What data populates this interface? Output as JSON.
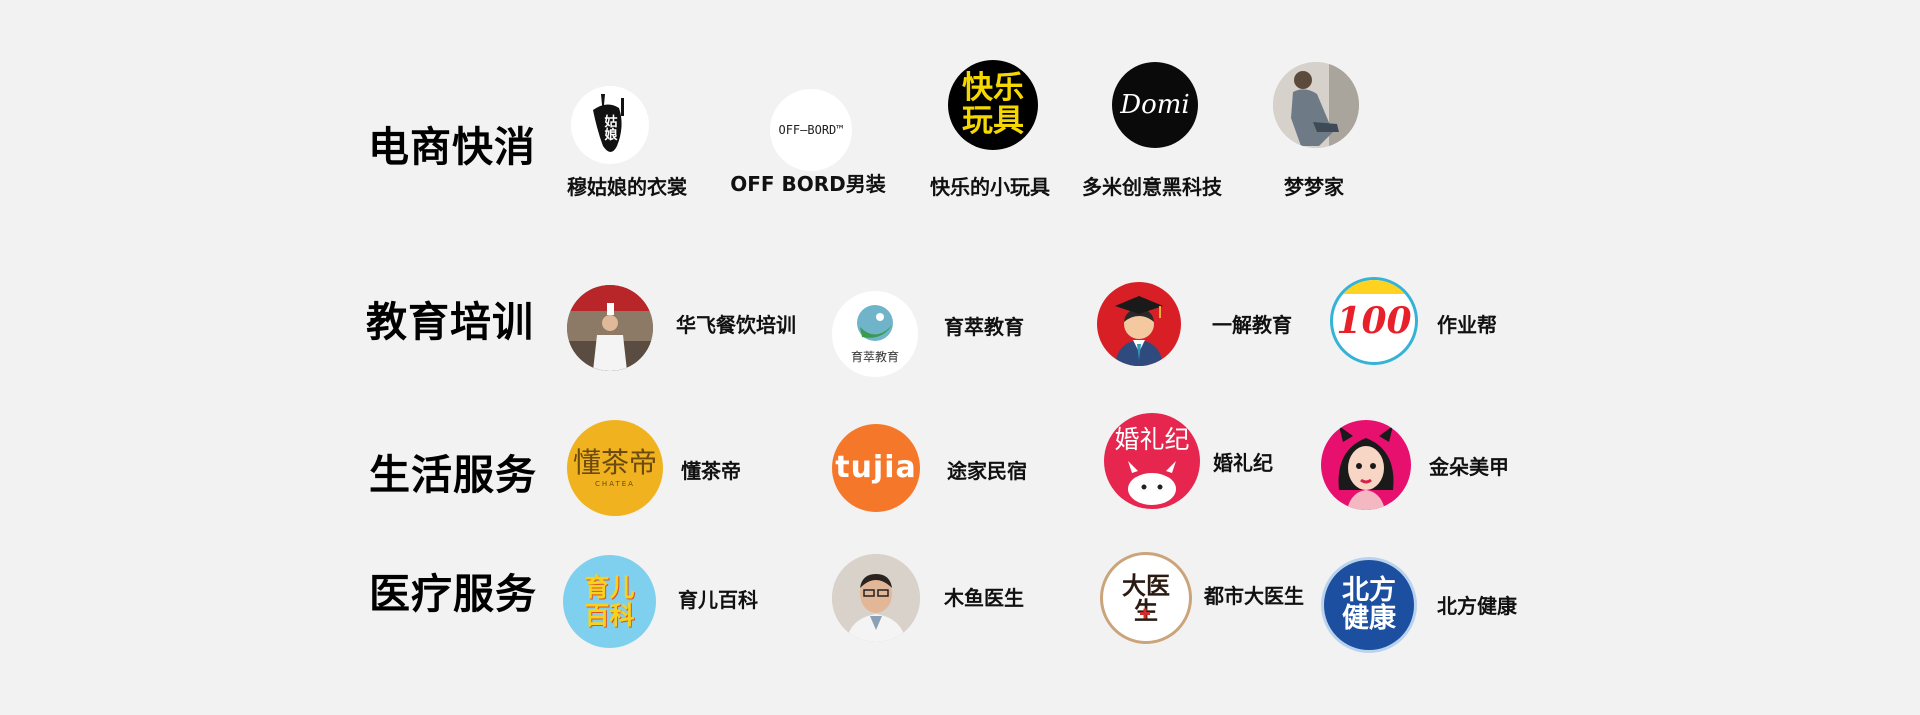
{
  "categories": {
    "ecommerce": "电商快消",
    "education": "教育培训",
    "life": "生活服务",
    "medical": "医疗服务"
  },
  "brands": {
    "mugu": {
      "name": "穆姑娘的衣裳",
      "logo_text": "姑娘"
    },
    "offbord": {
      "name": "OFF BORD男装",
      "logo_text": "OFF—BORD™"
    },
    "kuaile": {
      "name": "快乐的小玩具",
      "logo_text": "快乐玩具"
    },
    "duomi": {
      "name": "多米创意黑科技",
      "logo_text": "Domi"
    },
    "mengmeng": {
      "name": "梦梦家"
    },
    "huafei": {
      "name": "华飞餐饮培训"
    },
    "yucui": {
      "name": "育萃教育",
      "logo_text": "育萃教育"
    },
    "yijie": {
      "name": "一解教育"
    },
    "zuoye": {
      "name": "作业帮",
      "logo_text": "100"
    },
    "dongcha": {
      "name": "懂茶帝",
      "logo_text": "懂茶帝",
      "logo_sub": "CHATEA"
    },
    "tujia": {
      "name": "途家民宿",
      "logo_text": "tujia"
    },
    "hunli": {
      "name": "婚礼纪",
      "logo_text": "婚礼纪"
    },
    "jinduo": {
      "name": "金朵美甲"
    },
    "yuer": {
      "name": "育儿百科",
      "logo_text": "育儿百科"
    },
    "muyu": {
      "name": "木鱼医生"
    },
    "dushi": {
      "name": "都市大医生",
      "logo_text": "大医生"
    },
    "beifang": {
      "name": "北方健康",
      "logo_text": "北方健康"
    }
  },
  "colors": {
    "background": "#f2f2f2",
    "kuaile_bg": "#000000",
    "kuaile_text": "#f5d800",
    "duomi_bg": "#0a0a0a",
    "yijie_bg": "#d91f26",
    "zuoye_accent": "#e8202a",
    "dongcha_bg": "#f0b21f",
    "tujia_bg": "#f5772a",
    "hunli_bg": "#e6264e",
    "jinduo_bg": "#e8106f",
    "yuer_bg": "#7fd0ee",
    "beifang_bg": "#1c4fa0"
  }
}
